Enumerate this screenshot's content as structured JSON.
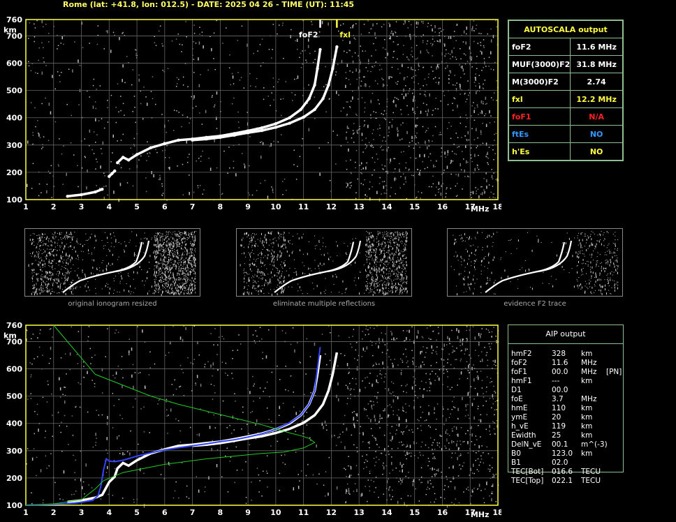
{
  "header": {
    "title": "Rome (lat: +41.8, lon: 012.5) - DATE: 2025 04 26 - TIME (UT): 11:45"
  },
  "autoscala": {
    "title": "AUTOSCALA output",
    "rows": [
      {
        "label": "foF2",
        "value": "11.6 MHz",
        "color": "#ffffff"
      },
      {
        "label": "MUF(3000)F2",
        "value": "31.8 MHz",
        "color": "#ffffff"
      },
      {
        "label": "M(3000)F2",
        "value": "2.74",
        "color": "#ffffff"
      },
      {
        "label": "fxl",
        "value": "12.2 MHz",
        "color": "#ffff44"
      },
      {
        "label": "foF1",
        "value": "N/A",
        "color": "#ff2222"
      },
      {
        "label": "ftEs",
        "value": "NO",
        "color": "#3399ff"
      },
      {
        "label": "h'Es",
        "value": "NO",
        "color": "#ffff44"
      }
    ]
  },
  "aip": {
    "title": "AIP output",
    "rows": [
      {
        "name": "hmF2",
        "value": "328",
        "unit": "km",
        "extra": ""
      },
      {
        "name": "foF2",
        "value": "11.6",
        "unit": "MHz",
        "extra": ""
      },
      {
        "name": "foF1",
        "value": "00.0",
        "unit": "MHz",
        "extra": "[PN]"
      },
      {
        "name": "hmF1",
        "value": "---",
        "unit": "km",
        "extra": ""
      },
      {
        "name": "D1",
        "value": "00.0",
        "unit": "",
        "extra": ""
      },
      {
        "name": "foE",
        "value": "3.7",
        "unit": "MHz",
        "extra": ""
      },
      {
        "name": "hmE",
        "value": "110",
        "unit": "km",
        "extra": ""
      },
      {
        "name": "ymE",
        "value": "20",
        "unit": "km",
        "extra": ""
      },
      {
        "name": "h_vE",
        "value": "119",
        "unit": "km",
        "extra": ""
      },
      {
        "name": "Ewidth",
        "value": "25",
        "unit": "km",
        "extra": ""
      },
      {
        "name": "DelN_vE",
        "value": "00.1",
        "unit": "m^(-3)",
        "extra": ""
      },
      {
        "name": "B0",
        "value": "123.0",
        "unit": "km",
        "extra": ""
      },
      {
        "name": "B1",
        "value": "02.0",
        "unit": "",
        "extra": ""
      },
      {
        "name": "TEC[Bot]",
        "value": "016.6",
        "unit": "TECU",
        "extra": ""
      },
      {
        "name": "TEC[Top]",
        "value": "022.1",
        "unit": "TECU",
        "extra": ""
      }
    ]
  },
  "thumbnails": {
    "captions": [
      "original ionogram resized",
      "eliminate multiple reflections",
      "evidence F2 trace"
    ]
  },
  "chart_data": [
    {
      "type": "scatter",
      "title": "",
      "xlabel": "MHz",
      "ylabel": "km",
      "xlim": [
        1,
        18
      ],
      "ylim": [
        100,
        760
      ],
      "x_ticks": [
        1,
        2,
        3,
        4,
        5,
        6,
        7,
        8,
        9,
        10,
        11,
        12,
        13,
        14,
        15,
        16,
        17,
        18
      ],
      "x_tick_labels": [
        "1",
        "2",
        "3",
        "4",
        "5",
        "6",
        "7",
        "8",
        "9",
        "10",
        "11",
        "12",
        "13",
        "14",
        "15",
        "16",
        "17",
        "MHz",
        "18"
      ],
      "y_ticks": [
        100,
        200,
        300,
        400,
        500,
        600,
        700,
        760
      ],
      "grid": true,
      "axis_color": "#ffff44",
      "markers": [
        {
          "label": "foF2",
          "x": 11.6,
          "color": "#ffffff"
        },
        {
          "label": "fxl",
          "x": 12.2,
          "color": "#ffff44"
        }
      ],
      "series": [
        {
          "color": "#ffffff",
          "x": [
            2.5,
            3.0,
            3.5,
            3.75
          ],
          "y": [
            112,
            118,
            128,
            138
          ]
        },
        {
          "color": "#ffffff",
          "x": [
            4.0,
            4.1,
            4.2
          ],
          "y": [
            185,
            195,
            205
          ]
        },
        {
          "color": "#ffffff",
          "x": [
            4.3,
            4.5,
            4.7,
            5.0,
            5.5,
            6.0,
            6.5,
            7.0,
            7.5,
            8.0,
            8.5,
            9.0,
            9.5,
            10.0,
            10.5,
            10.9,
            11.2,
            11.4,
            11.5,
            11.6
          ],
          "y": [
            235,
            255,
            245,
            265,
            290,
            305,
            318,
            322,
            328,
            333,
            342,
            352,
            363,
            378,
            400,
            430,
            470,
            520,
            580,
            650
          ]
        },
        {
          "color": "#ffffff",
          "x": [
            7.0,
            7.5,
            8.0,
            8.5,
            9.0,
            9.5,
            10.0,
            10.5,
            11.0,
            11.4,
            11.7,
            11.9,
            12.05,
            12.2
          ],
          "y": [
            318,
            322,
            328,
            336,
            345,
            353,
            365,
            380,
            402,
            430,
            470,
            520,
            580,
            660
          ]
        }
      ]
    },
    {
      "type": "line",
      "title": "",
      "xlabel": "MHz",
      "ylabel": "km",
      "xlim": [
        1,
        18
      ],
      "ylim": [
        100,
        760
      ],
      "x_ticks": [
        1,
        2,
        3,
        4,
        5,
        6,
        7,
        8,
        9,
        10,
        11,
        12,
        13,
        14,
        15,
        16,
        17,
        18
      ],
      "x_tick_labels": [
        "1",
        "2",
        "3",
        "4",
        "5",
        "6",
        "7",
        "8",
        "9",
        "10",
        "11",
        "12",
        "13",
        "14",
        "15",
        "16",
        "17",
        "MHz",
        "18"
      ],
      "y_ticks": [
        100,
        200,
        300,
        400,
        500,
        600,
        700,
        760
      ],
      "grid": true,
      "axis_color": "#ffff44",
      "series": [
        {
          "color": "#ffffff",
          "x": [
            2.5,
            3.0,
            3.5,
            3.75,
            4.0,
            4.2,
            4.3,
            4.5,
            4.7,
            5.0,
            5.5,
            6.0,
            6.5,
            7.0,
            7.5,
            8.0,
            8.5,
            9.0,
            9.5,
            10.0,
            10.5,
            10.9,
            11.2,
            11.4,
            11.5,
            11.6
          ],
          "y": [
            112,
            118,
            128,
            138,
            185,
            205,
            235,
            255,
            245,
            265,
            290,
            305,
            318,
            322,
            328,
            333,
            342,
            352,
            363,
            378,
            400,
            430,
            470,
            520,
            580,
            650
          ]
        },
        {
          "color": "#ffffff",
          "x": [
            7.0,
            7.5,
            8.0,
            8.5,
            9.0,
            9.5,
            10.0,
            10.5,
            11.0,
            11.4,
            11.7,
            11.9,
            12.05,
            12.2
          ],
          "y": [
            318,
            322,
            328,
            336,
            345,
            353,
            365,
            380,
            402,
            430,
            470,
            520,
            580,
            660
          ]
        },
        {
          "color": "#3344ff",
          "x": [
            1.0,
            2.0,
            2.8,
            3.4,
            3.6,
            3.7,
            3.8,
            3.9,
            4.0,
            4.2,
            4.5,
            5.0,
            5.5,
            6.0,
            6.5,
            7.0,
            7.5,
            8.0,
            8.5,
            9.0,
            9.5,
            10.0,
            10.5,
            10.9,
            11.2,
            11.4,
            11.5,
            11.6
          ],
          "y": [
            100,
            103,
            108,
            118,
            135,
            170,
            230,
            270,
            262,
            260,
            265,
            280,
            292,
            303,
            311,
            318,
            325,
            333,
            340,
            350,
            362,
            378,
            402,
            430,
            470,
            520,
            600,
            680
          ]
        },
        {
          "color": "#22cc22",
          "x": [
            2.0,
            2.5,
            3.0,
            3.5,
            4.5,
            5.5,
            6.5,
            7.5,
            8.5,
            9.5,
            10.0,
            10.5,
            10.9,
            11.2,
            11.4,
            11.0,
            10.3,
            9.5,
            8.5,
            7.5,
            6.0,
            4.5,
            3.8,
            3.5,
            3.0,
            2.0,
            1.0
          ],
          "y": [
            760,
            700,
            640,
            580,
            540,
            500,
            470,
            445,
            420,
            395,
            380,
            365,
            355,
            345,
            330,
            310,
            295,
            290,
            280,
            270,
            250,
            220,
            190,
            160,
            120,
            105,
            100
          ]
        }
      ]
    }
  ]
}
